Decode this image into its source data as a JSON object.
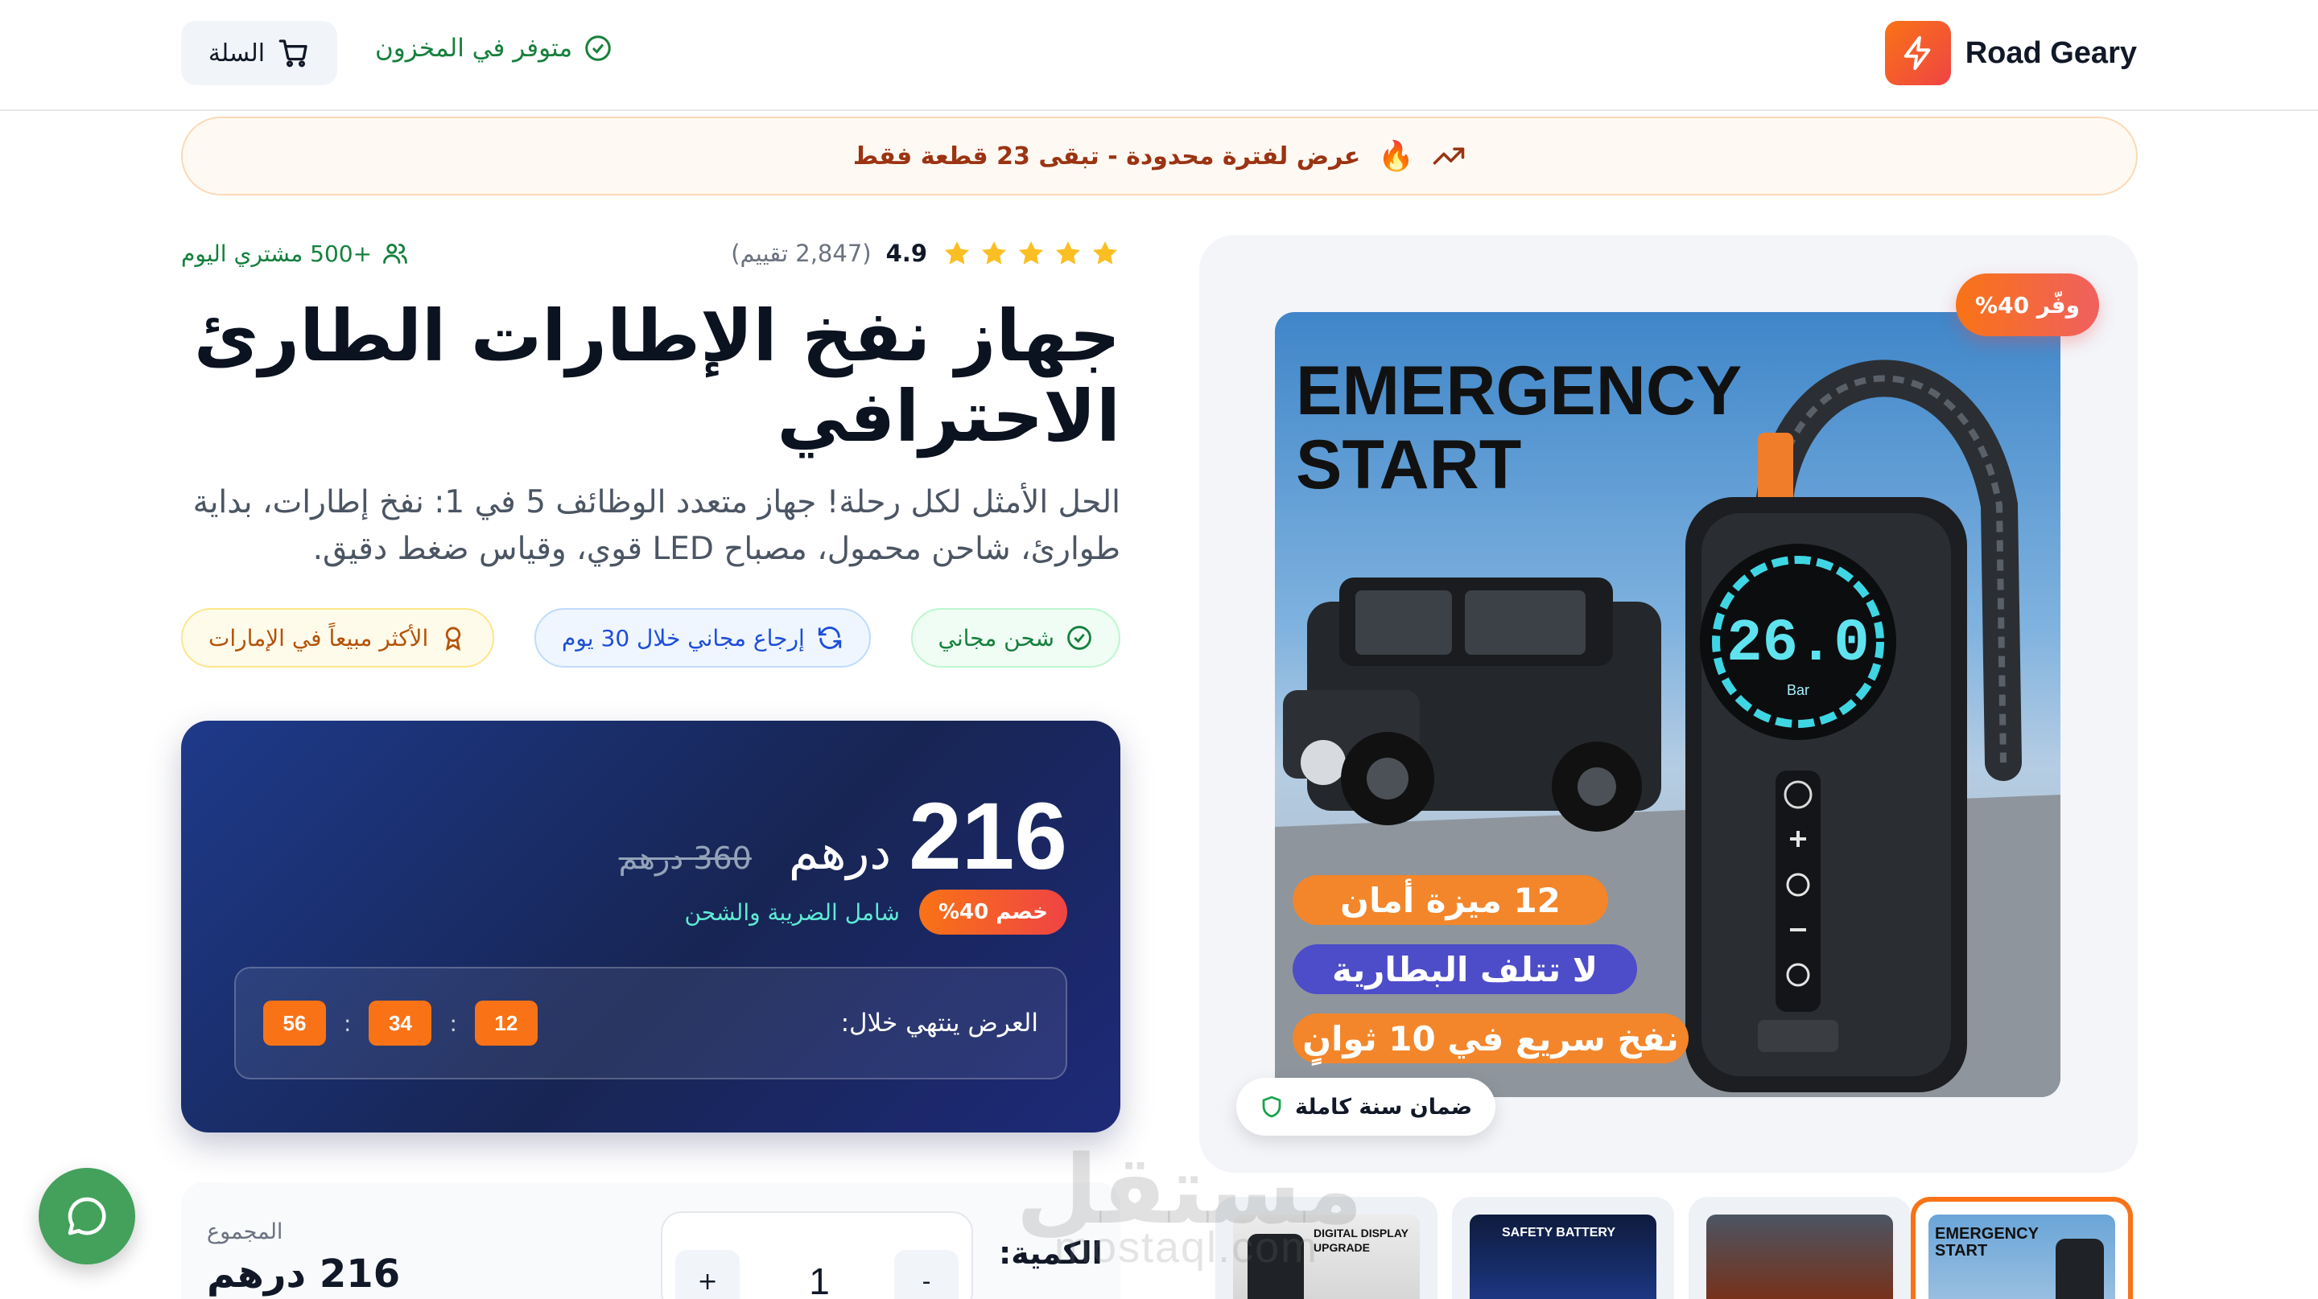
{
  "header": {
    "brand": "Road Geary",
    "stock": "متوفر في المخزون",
    "cart_label": "السلة"
  },
  "promo": {
    "text": "عرض لفترة محدودة - تبقى 23 قطعة فقط",
    "fire": "🔥"
  },
  "product": {
    "rating": "4.9",
    "rating_count": "(2,847 تقييم)",
    "stars": 5,
    "buyers": "+500 مشتري اليوم",
    "title": "جهاز نفخ الإطارات الطارئ الاحترافي",
    "subtitle": "الحل الأمثل لكل رحلة! جهاز متعدد الوظائف 5 في 1: نفخ إطارات، بداية طوارئ، شاحن محمول، مصباح LED قوي، وقياس ضغط دقيق.",
    "badges": [
      "شحن مجاني",
      "إرجاع مجاني خلال 30 يوم",
      "الأكثر مبيعاً في الإمارات"
    ]
  },
  "price": {
    "amount": "216",
    "currency": "درهم",
    "old": "360 درهم",
    "discount": "خصم 40%",
    "tax_note": "شامل الضريبة والشحن",
    "timer_label": "العرض ينتهي خلال:",
    "timer": [
      "12",
      "34",
      "56"
    ],
    "separator": ":"
  },
  "quantity": {
    "label": "الكمية:",
    "value": "1",
    "plus": "+",
    "minus": "-",
    "total_label": "المجموع",
    "total_value": "216 درهم"
  },
  "gallery": {
    "save": "وفّر 40%",
    "warranty": "ضمان سنة كاملة",
    "image_title_1": "EMERGENCY",
    "image_title_2": "START",
    "features": [
      "12 ميزة أمان",
      "لا تتلف البطارية",
      "نفخ سريع في 10 ثوانٍ"
    ],
    "display_value": "26.0",
    "display_unit": "Bar",
    "thumbs": [
      {
        "line1": "EMERGENCY",
        "line2": "START"
      },
      {
        "line1": "",
        "line2": ""
      },
      {
        "line1": "SAFETY BATTERY",
        "line2": ""
      },
      {
        "line1": "DIGITAL DISPLAY",
        "line2": "UPGRADE"
      }
    ]
  },
  "watermark": {
    "text": "مستقل",
    "sub": "mostaql.com"
  },
  "colors": {
    "accent": "#f97316",
    "brand_gradient_end": "#ef4444",
    "price_card": "#1e3a8a",
    "stock_green": "#16803c",
    "chat": "#43a15b"
  },
  "icons": [
    "zap-icon",
    "cart-icon",
    "check-circle-icon",
    "trend-up-icon",
    "star-icon",
    "users-icon",
    "refresh-icon",
    "award-icon",
    "shield-icon",
    "chat-icon"
  ]
}
